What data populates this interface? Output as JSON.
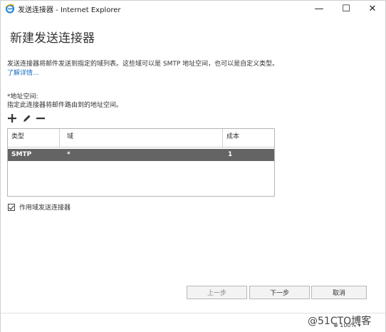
{
  "window": {
    "title": "发送连接器 - Internet Explorer",
    "minimize_glyph": "—",
    "maximize_glyph": "☐",
    "close_glyph": "✕"
  },
  "page": {
    "title": "新建发送连接器",
    "description": "发送连接器将邮件发送到指定的域列表。这些域可以是 SMTP 地址空间，也可以是自定义类型。",
    "learn_more": "了解详情..."
  },
  "address_space": {
    "label": "*地址空间:",
    "hint": "指定此连接器将邮件路由到的地址空间。",
    "toolbar": [
      "add-icon",
      "edit-icon",
      "remove-icon"
    ],
    "columns": [
      "类型",
      "域",
      "成本"
    ],
    "rows": [
      {
        "type": "SMTP",
        "domain": "*",
        "cost": "1"
      }
    ]
  },
  "scoped": {
    "checked": true,
    "label": "作用域发送连接器"
  },
  "buttons": {
    "prev": "上一步",
    "next": "下一步",
    "cancel": "取消"
  },
  "status": {
    "zoom": "100%"
  },
  "watermark": "@51CTO博客",
  "colors": {
    "selected_row": "#646464",
    "link": "#1a6ec2",
    "ie_blue": "#2b8ad6"
  }
}
